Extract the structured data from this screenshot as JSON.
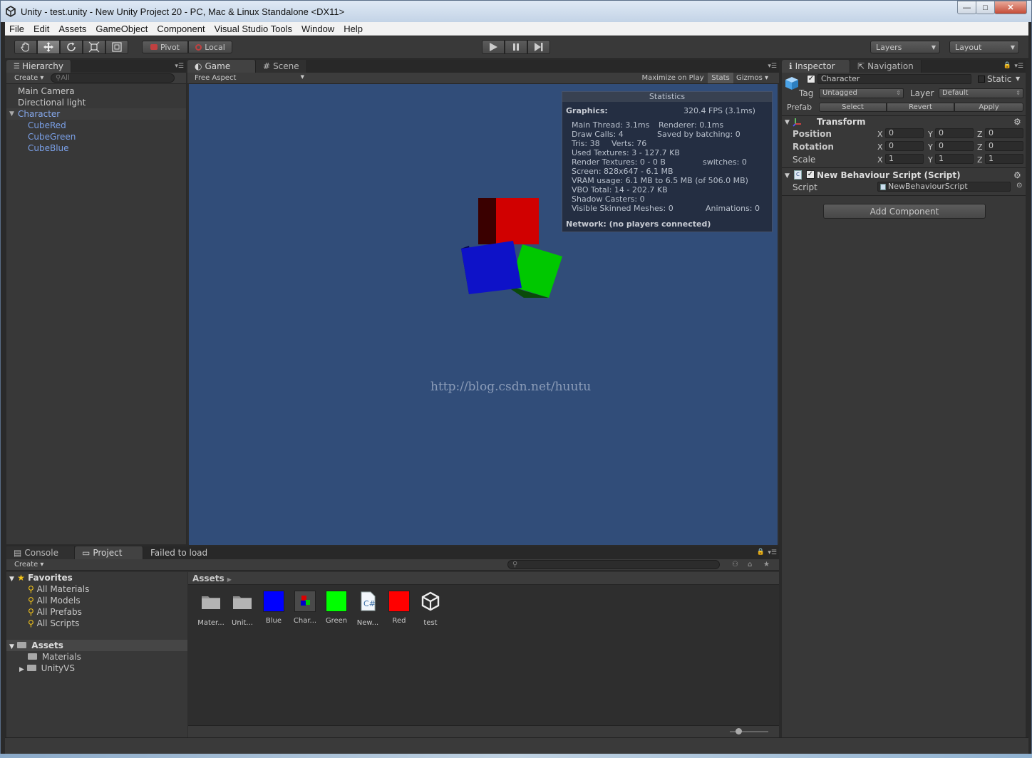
{
  "window": {
    "title": "Unity - test.unity - New Unity Project 20 - PC, Mac & Linux Standalone <DX11>",
    "controls": {
      "minimize": "—",
      "maximize": "□",
      "close": "✕"
    }
  },
  "menu": [
    "File",
    "Edit",
    "Assets",
    "GameObject",
    "Component",
    "Visual Studio Tools",
    "Window",
    "Help"
  ],
  "toolbar": {
    "pivot": "Pivot",
    "local": "Local",
    "layers": "Layers",
    "layout": "Layout"
  },
  "hierarchy": {
    "tab": "Hierarchy",
    "create": "Create",
    "search_placeholder": "All",
    "items": [
      "Main Camera",
      "Directional light",
      "Character",
      "CubeRed",
      "CubeGreen",
      "CubeBlue"
    ]
  },
  "game": {
    "tab_game": "Game",
    "tab_scene": "Scene",
    "aspect": "Free Aspect",
    "maximize": "Maximize on Play",
    "stats_btn": "Stats",
    "gizmos": "Gizmos",
    "watermark": "http://blog.csdn.net/huutu",
    "stats": {
      "header": "Statistics",
      "graphics": "Graphics:",
      "fps": "320.4 FPS (3.1ms)",
      "main_thread": "Main Thread: 3.1ms",
      "renderer": "Renderer: 0.1ms",
      "draw_calls": "Draw Calls: 4",
      "batching": "Saved by batching: 0",
      "tris": "Tris: 38",
      "verts": "Verts: 76",
      "textures": "Used Textures: 3 - 127.7 KB",
      "render_textures": "Render Textures: 0 - 0 B",
      "switches": "switches: 0",
      "screen": "Screen: 828x647 - 6.1 MB",
      "vram": "VRAM usage: 6.1 MB to 6.5 MB (of 506.0 MB)",
      "vbo": "VBO Total: 14 - 202.7 KB",
      "shadow": "Shadow Casters: 0",
      "skinned": "Visible Skinned Meshes: 0",
      "animations": "Animations: 0",
      "network": "Network: (no players connected)"
    },
    "colors": {
      "background": "#314d79",
      "cube_red": "#d10000",
      "cube_green": "#00c800",
      "cube_blue": "#0e12c8"
    }
  },
  "inspector": {
    "tab_inspector": "Inspector",
    "tab_navigation": "Navigation",
    "object_name": "Character",
    "static": "Static",
    "tag_label": "Tag",
    "tag_value": "Untagged",
    "layer_label": "Layer",
    "layer_value": "Default",
    "prefab_label": "Prefab",
    "select": "Select",
    "revert": "Revert",
    "apply": "Apply",
    "transform": {
      "title": "Transform",
      "position": "Position",
      "rotation": "Rotation",
      "scale": "Scale",
      "x": "X",
      "y": "Y",
      "z": "Z",
      "pos": [
        "0",
        "0",
        "0"
      ],
      "rot": [
        "0",
        "0",
        "0"
      ],
      "scl": [
        "1",
        "1",
        "1"
      ]
    },
    "script": {
      "title": "New Behaviour Script (Script)",
      "label": "Script",
      "value": "NewBehaviourScript"
    },
    "add_component": "Add Component"
  },
  "bottom": {
    "tab_console": "Console",
    "tab_project": "Project",
    "status_text": "Failed to load",
    "create": "Create",
    "favorites": "Favorites",
    "fav_items": [
      "All Materials",
      "All Models",
      "All Prefabs",
      "All Scripts"
    ],
    "assets_root": "Assets",
    "folders": [
      "Materials",
      "UnityVS"
    ],
    "breadcrumb": "Assets",
    "assets": [
      {
        "name": "Mater...",
        "icon": "folder-icon"
      },
      {
        "name": "Unit...",
        "icon": "folder-icon"
      },
      {
        "name": "Blue",
        "icon": "material-blue-icon",
        "color": "#0000ff"
      },
      {
        "name": "Char...",
        "icon": "prefab-icon"
      },
      {
        "name": "Green",
        "icon": "material-green-icon",
        "color": "#00ff00"
      },
      {
        "name": "New...",
        "icon": "csharp-script-icon"
      },
      {
        "name": "Red",
        "icon": "material-red-icon",
        "color": "#ff0000"
      },
      {
        "name": "test",
        "icon": "unity-scene-icon"
      }
    ]
  }
}
